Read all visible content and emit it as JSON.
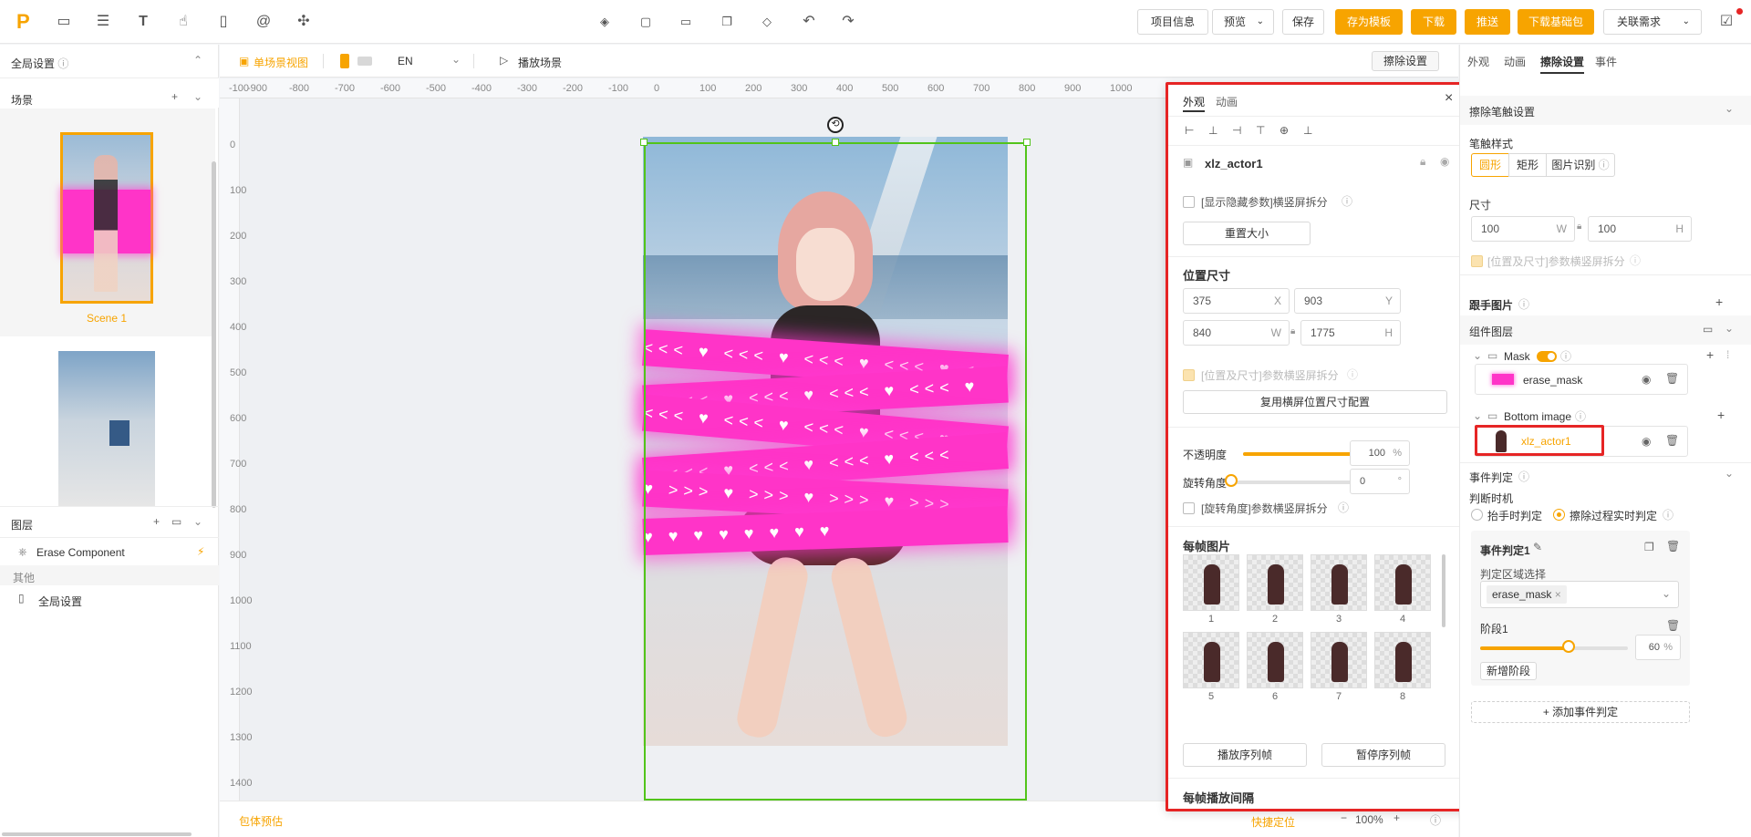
{
  "topbar": {
    "logo": "P",
    "left_icons": [
      "inbox-icon",
      "layout-icon",
      "text-icon",
      "hand-icon",
      "phone-icon",
      "at-icon",
      "puzzle-icon"
    ],
    "center_icons": [
      "layers-icon",
      "folder-icon",
      "open-folder-icon",
      "copy-icon",
      "diamond-icon",
      "undo-icon",
      "redo-icon"
    ],
    "project_info": "项目信息",
    "preview": "预览",
    "save": "保存",
    "save_template": "存为模板",
    "download": "下载",
    "push": "推送",
    "download_base": "下载基础包",
    "related_req": "关联需求"
  },
  "left": {
    "global_settings": "全局设置",
    "scenes_label": "场景",
    "scene1_name": "Scene 1",
    "layers_label": "图层",
    "erase_component": "Erase Component",
    "others_label": "其他",
    "global_item": "全局设置"
  },
  "subbar": {
    "single_scene_view": "单场景视图",
    "language": "EN",
    "play_scene": "播放场景",
    "erase_settings": "擦除设置"
  },
  "ruler": {
    "h": [
      "-100",
      "-900",
      "-800",
      "-700",
      "-600",
      "-500",
      "-400",
      "-300",
      "-200",
      "-100",
      "0",
      "100",
      "200",
      "300",
      "400",
      "500",
      "600",
      "700",
      "800",
      "900",
      "1000"
    ],
    "v": [
      "0",
      "100",
      "200",
      "300",
      "400",
      "500",
      "600",
      "700",
      "800",
      "900",
      "1000",
      "1100",
      "1200",
      "1300",
      "1400"
    ]
  },
  "bottom": {
    "bundle_estimate": "包体预估",
    "quick_locate": "快捷定位",
    "zoom": "100%"
  },
  "float_panel": {
    "tab_appearance": "外观",
    "tab_animation": "动画",
    "object_name": "xlz_actor1",
    "show_hidden": "[显示隐藏参数]横竖屏拆分",
    "reset_size": "重置大小",
    "pos_size": "位置尺寸",
    "x_val": "375",
    "x_suf": "X",
    "y_val": "903",
    "y_suf": "Y",
    "w_val": "840",
    "w_suf": "W",
    "h_val": "1775",
    "h_suf": "H",
    "pos_split": "[位置及尺寸]参数横竖屏拆分",
    "reuse_landscape": "复用横屏位置尺寸配置",
    "opacity_label": "不透明度",
    "opacity_val": "100",
    "opacity_level": 100,
    "opacity_unit": "%",
    "rotation_label": "旋转角度",
    "rotation_val": "0",
    "rotation_unit": "°",
    "rotation_split": "[旋转角度]参数横竖屏拆分",
    "frame_images": "每帧图片",
    "frames": [
      "1",
      "2",
      "3",
      "4",
      "5",
      "6",
      "7",
      "8"
    ],
    "play_seq": "播放序列帧",
    "pause_seq": "暂停序列帧",
    "frame_interval": "每帧播放间隔"
  },
  "right": {
    "tab_appearance": "外观",
    "tab_animation": "动画",
    "tab_erase": "擦除设置",
    "tab_event": "事件",
    "erase_brush": "擦除笔触设置",
    "brush_style": "笔触样式",
    "style_circle": "圆形",
    "style_rect": "矩形",
    "style_image": "图片识别",
    "size_label": "尺寸",
    "w_val": "100",
    "w_suf": "W",
    "h_val": "100",
    "h_suf": "H",
    "pos_split": "[位置及尺寸]参数横竖屏拆分",
    "follow_image": "跟手图片",
    "component_layers": "组件图层",
    "mask_label": "Mask",
    "erase_mask": "erase_mask",
    "bottom_image": "Bottom image",
    "actor": "xlz_actor1",
    "event_judge": "事件判定",
    "judge_timing": "判断时机",
    "on_lift": "抬手时判定",
    "realtime": "擦除过程实时判定",
    "event1": "事件判定1",
    "region_select": "判定区域选择",
    "region_tag": "erase_mask",
    "stage1": "阶段1",
    "stage_val": "60",
    "stage_level": 60,
    "stage_unit": "%",
    "add_stage": "新增阶段",
    "add_event": "添加事件判定"
  },
  "colors": {
    "accent": "#f7a400",
    "highlight": "#e62525",
    "selection": "#52c41a",
    "ribbon": "#ff34c8"
  }
}
